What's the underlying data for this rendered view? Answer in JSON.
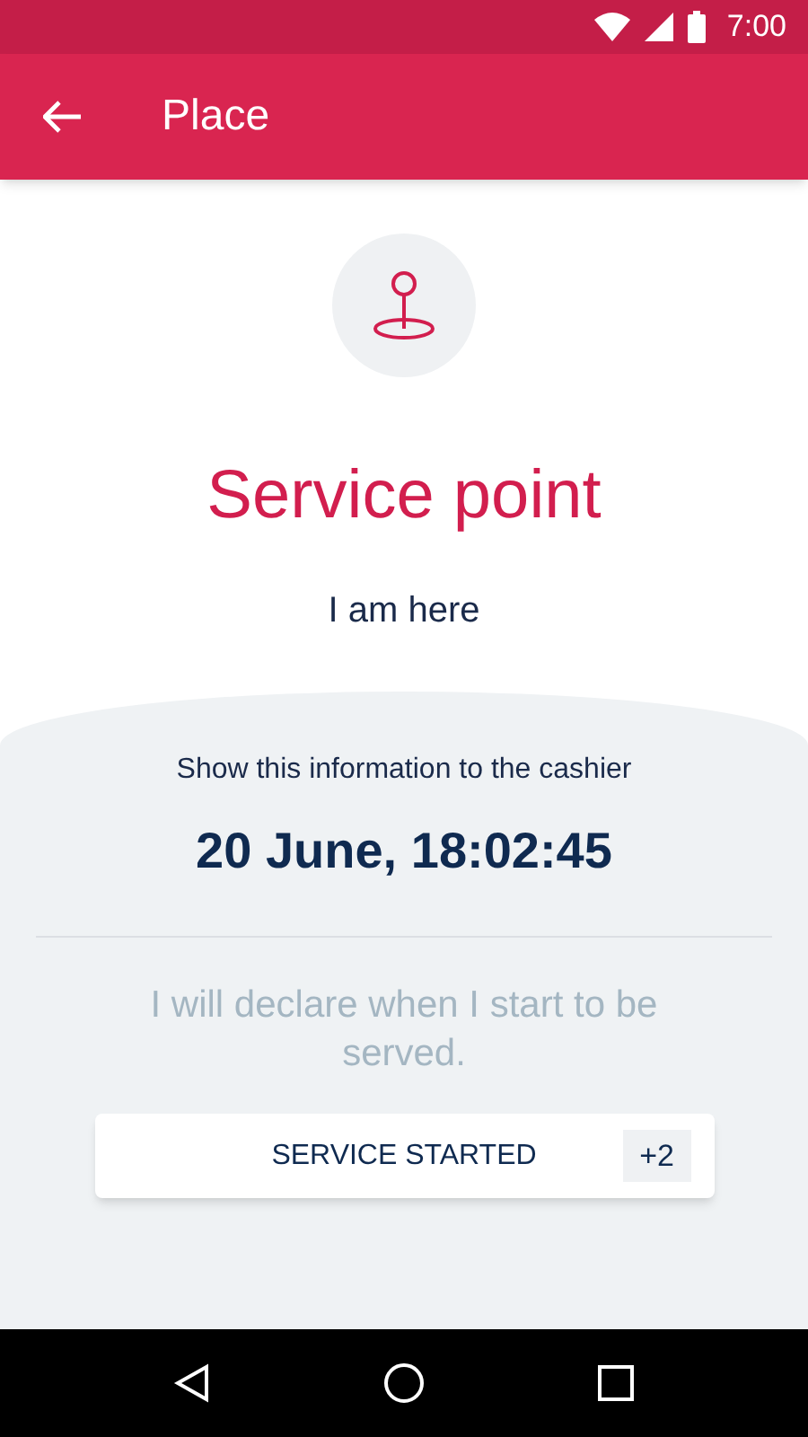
{
  "status_bar": {
    "time": "7:00"
  },
  "app_bar": {
    "title": "Place"
  },
  "place": {
    "title": "Service point",
    "subtitle": "I am here"
  },
  "info": {
    "caption": "Show this information to the cashier",
    "datetime": "20 June, 18:02:45",
    "note": "I will declare when I start to be served."
  },
  "button": {
    "label": "SERVICE STARTED",
    "badge": "+2"
  }
}
